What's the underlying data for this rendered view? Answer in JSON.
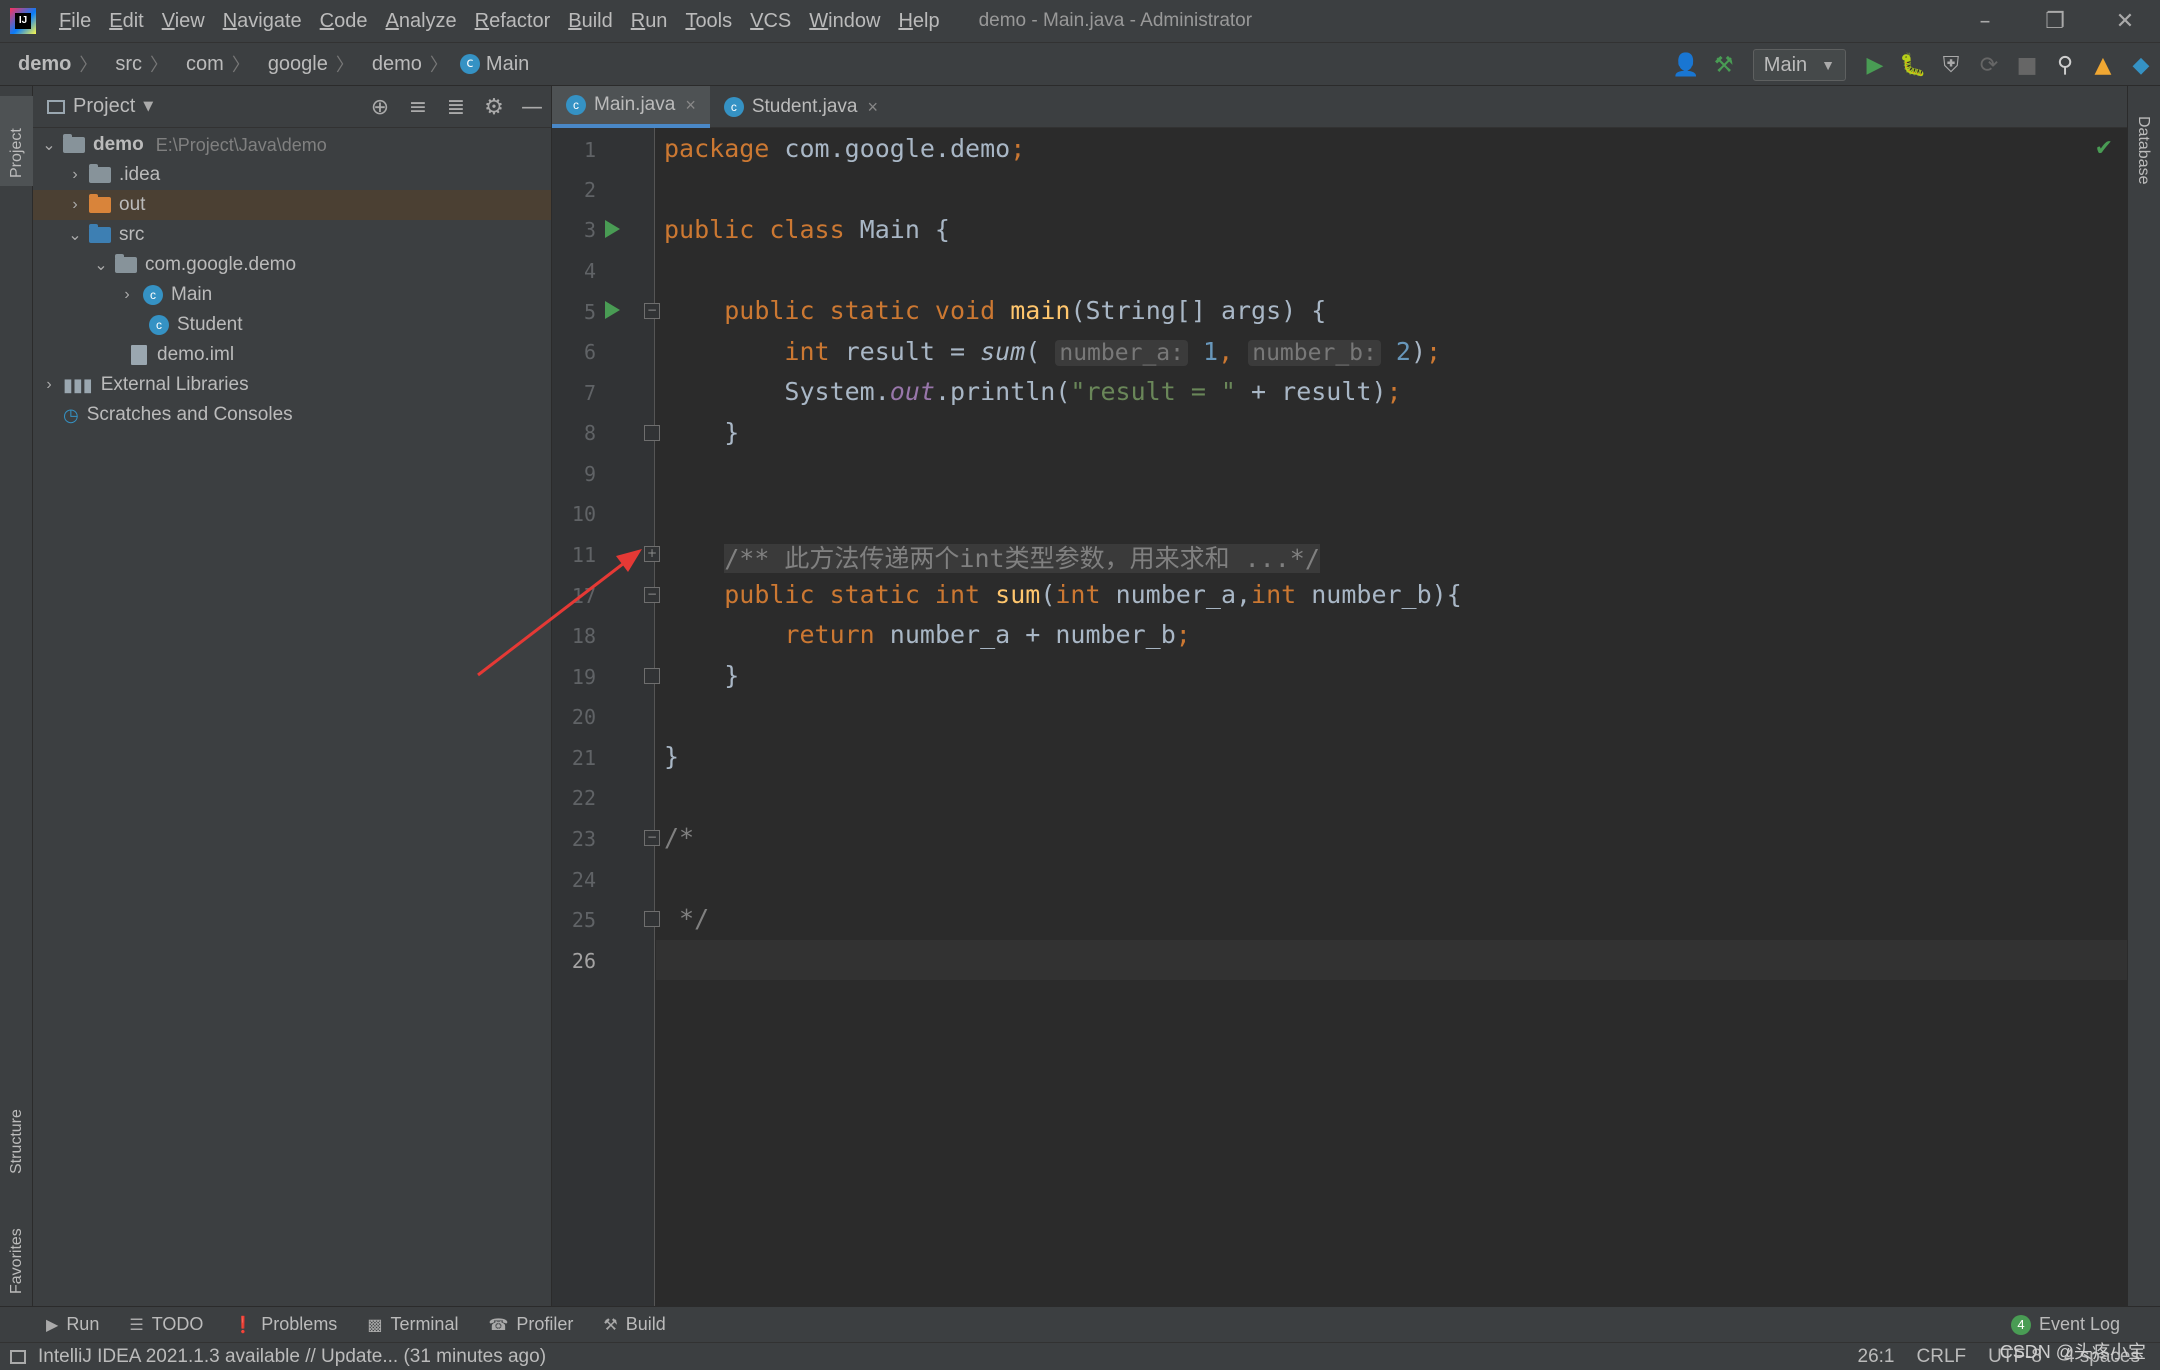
{
  "menubar": {
    "items": [
      "File",
      "Edit",
      "View",
      "Navigate",
      "Code",
      "Analyze",
      "Refactor",
      "Build",
      "Run",
      "Tools",
      "VCS",
      "Window",
      "Help"
    ],
    "title": "demo - Main.java - Administrator"
  },
  "breadcrumbs": [
    "demo",
    "src",
    "com",
    "google",
    "demo",
    "Main"
  ],
  "run_config": "Main",
  "project_panel": {
    "title": "Project",
    "tree": [
      {
        "label": "demo",
        "path": "E:\\Project\\Java\\demo",
        "type": "module"
      },
      {
        "label": ".idea",
        "type": "folder"
      },
      {
        "label": "out",
        "type": "folder-excluded",
        "selected": true
      },
      {
        "label": "src",
        "type": "source-folder"
      },
      {
        "label": "com.google.demo",
        "type": "package"
      },
      {
        "label": "Main",
        "type": "class"
      },
      {
        "label": "Student",
        "type": "class"
      },
      {
        "label": "demo.iml",
        "type": "file"
      },
      {
        "label": "External Libraries",
        "type": "library"
      },
      {
        "label": "Scratches and Consoles",
        "type": "scratches"
      }
    ]
  },
  "left_strip": {
    "project": "Project",
    "structure": "Structure",
    "favorites": "Favorites"
  },
  "right_strip": {
    "database": "Database"
  },
  "tabs": [
    {
      "label": "Main.java",
      "active": true
    },
    {
      "label": "Student.java",
      "active": false
    }
  ],
  "editor": {
    "line_numbers": [
      "1",
      "2",
      "3",
      "4",
      "5",
      "6",
      "7",
      "8",
      "9",
      "10",
      "11",
      "17",
      "18",
      "19",
      "20",
      "21",
      "22",
      "23",
      "24",
      "25",
      "26"
    ],
    "current_line": "26",
    "code": {
      "l1_kw": "package",
      "l1_rest": " com.google.demo",
      "l3_kw": "public class",
      "l3_rest": " Main {",
      "l5_kw": "public static void",
      "l5_fn": "main",
      "l5_rest": "(String[] args) {",
      "l6_kw": "int",
      "l6_a": " result = ",
      "l6_fn": "sum",
      "l6_hint_a": "number_a:",
      "l6_v1": "1",
      "l6_hint_b": "number_b:",
      "l6_v2": "2",
      "l7_a": "System.",
      "l7_field": "out",
      "l7_b": ".println(",
      "l7_str": "\"result = \"",
      "l7_c": " + result)",
      "l8": "}",
      "l11_folded": "/** 此方法传递两个int类型参数，用来求和 ...*/",
      "l17_kw": "public static int",
      "l17_fn": "sum",
      "l17_a": "(",
      "l17_kw2": "int",
      "l17_b": " number_a,",
      "l17_kw3": "int",
      "l17_c": " number_b){",
      "l18_kw": "return",
      "l18_rest": " number_a + number_b",
      "l19": "}",
      "l21": "}",
      "l23": "/*",
      "l25": " */"
    }
  },
  "bottom_tools": [
    "Run",
    "TODO",
    "Problems",
    "Terminal",
    "Profiler",
    "Build"
  ],
  "event_log": {
    "badge": "4",
    "label": "Event Log"
  },
  "status": {
    "message": "IntelliJ IDEA 2021.1.3 available // Update... (31 minutes ago)",
    "position": "26:1",
    "line_sep": "CRLF",
    "encoding": "UTF-8",
    "indent": "4 spaces"
  },
  "watermark": "CSDN @头疼小宝",
  "colors": {
    "keyword": "#cc7832",
    "function": "#ffc66d",
    "string": "#6a8759",
    "number": "#6897bb",
    "annotation_arrow": "#e53935"
  }
}
